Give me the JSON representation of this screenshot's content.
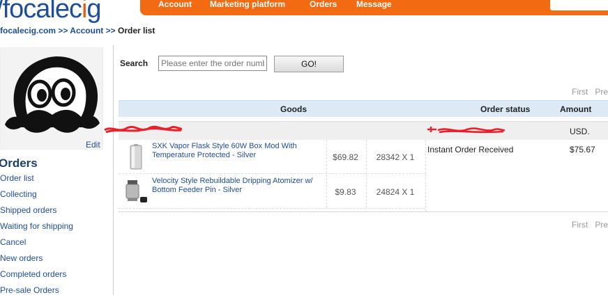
{
  "brand": {
    "logo_prefix": "/",
    "logo_main": "focalec",
    "logo_accent": "i",
    "logo_end": "g"
  },
  "topnav": {
    "items": [
      "Account",
      "Marketing platform",
      "Orders",
      "Message"
    ]
  },
  "breadcrumb": {
    "home": "focalecig.com",
    "sep": ">>",
    "account": "Account",
    "current": "Order list"
  },
  "sidebar": {
    "edit_label": "Edit",
    "heading": "Orders",
    "menu": [
      "Order list",
      "Collecting",
      "Shipped orders",
      "Waiting for shipping",
      "Cancel",
      "New orders",
      "Completed orders",
      "Pre-sale Orders"
    ]
  },
  "search": {
    "label": "Search",
    "placeholder": "Please enter the order number",
    "button_label": "GO!"
  },
  "pager": {
    "first": "First",
    "prev": "Pre"
  },
  "table": {
    "headers": {
      "goods": "Goods",
      "status": "Order status",
      "amount": "Amount"
    },
    "order": {
      "currency": "USD.",
      "status": "Instant Order Received",
      "amount": "$75.67",
      "items": [
        {
          "title": "SXK Vapor Flask Style 60W Box Mod With Temperature Protected - Silver",
          "price": "$69.82",
          "qty": "28342 X 1",
          "icon": "box-mod-icon"
        },
        {
          "title": "Velocity Style Rebuildable Dripping Atomizer w/ Bottom Feeder Pin - Silver",
          "price": "$9.83",
          "qty": "24824 X 1",
          "icon": "atomizer-icon"
        }
      ]
    }
  },
  "colors": {
    "nav_orange": "#f26b12",
    "link_blue": "#1d4e9a",
    "header_blue": "#dde9f5",
    "redaction_red": "#e8202a"
  }
}
